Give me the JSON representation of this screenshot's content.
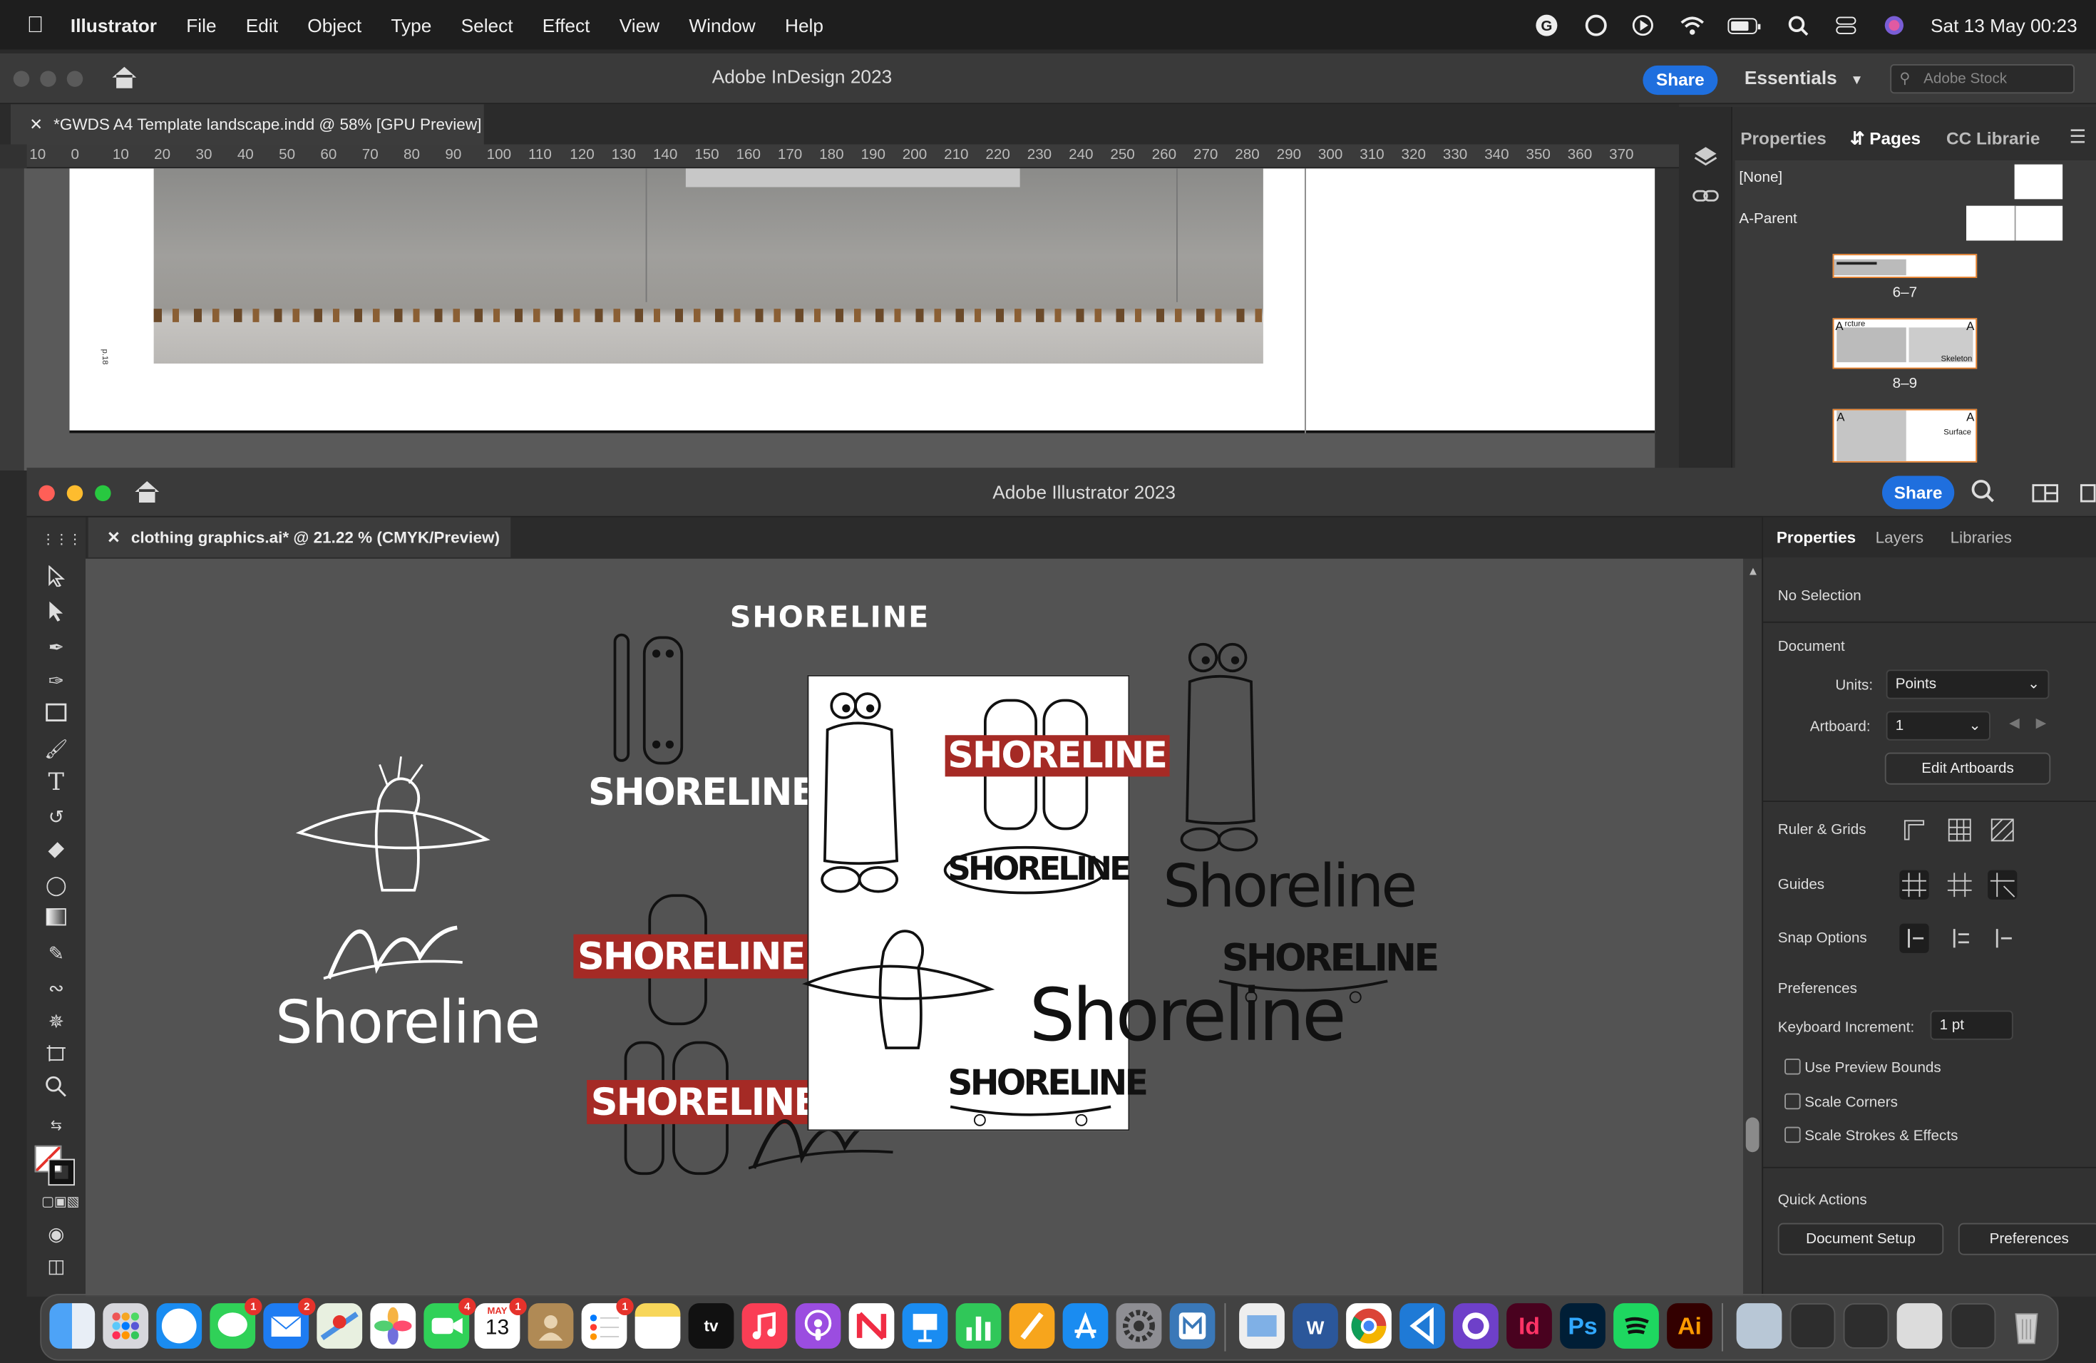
{
  "menubar": {
    "app": "Illustrator",
    "items": [
      "File",
      "Edit",
      "Object",
      "Type",
      "Select",
      "Effect",
      "View",
      "Window",
      "Help"
    ],
    "datetime": "Sat 13 May  00:23"
  },
  "indesign": {
    "title": "Adobe InDesign 2023",
    "share": "Share",
    "workspace": "Essentials",
    "stock_placeholder": "Adobe Stock",
    "doc_tab": "*GWDS A4 Template landscape.indd @ 58% [GPU Preview]",
    "ruler": [
      "10",
      "0",
      "10",
      "20",
      "30",
      "40",
      "50",
      "60",
      "70",
      "80",
      "90",
      "100",
      "110",
      "120",
      "130",
      "140",
      "150",
      "160",
      "170",
      "180",
      "190",
      "200",
      "210",
      "220",
      "230",
      "240",
      "250",
      "260",
      "270",
      "280",
      "290",
      "300",
      "310",
      "320",
      "330",
      "340",
      "350",
      "360",
      "370"
    ],
    "page_label": "p.18",
    "panel_tabs": [
      "Properties",
      "Pages",
      "CC Librarie"
    ],
    "parents": [
      "[None]",
      "A-Parent"
    ],
    "spreads": [
      "6–7",
      "8–9"
    ],
    "thumb_text": [
      "rcture",
      "Skeleton",
      "Surface"
    ],
    "parent_marker": "A"
  },
  "illustrator": {
    "title": "Adobe Illustrator 2023",
    "share": "Share",
    "doc_tab": "clothing graphics.ai* @ 21.22 % (CMYK/Preview)",
    "panel_tabs": [
      "Properties",
      "Layers",
      "Libraries"
    ],
    "no_selection": "No Selection",
    "document": "Document",
    "units_label": "Units:",
    "units_value": "Points",
    "artboard_label": "Artboard:",
    "artboard_value": "1",
    "edit_artboards": "Edit Artboards",
    "ruler_grids": "Ruler & Grids",
    "guides": "Guides",
    "snap_options": "Snap Options",
    "preferences_header": "Preferences",
    "keyboard_increment": "Keyboard Increment:",
    "keyboard_increment_value": "1 pt",
    "checkboxes": [
      "Use Preview Bounds",
      "Scale Corners",
      "Scale Strokes & Effects"
    ],
    "quick_actions": "Quick Actions",
    "document_setup": "Document Setup",
    "preferences_btn": "Preferences"
  },
  "artwork": {
    "shoreline_caps": "SHORELINE",
    "shoreline_script": "Shoreline",
    "shoreline_mixed": "SHORELINE",
    "signature": "AW"
  },
  "dock": {
    "badges": {
      "messages": "1",
      "mail": "2",
      "facetime": "4",
      "calendar": "1",
      "reminders": "1"
    },
    "calendar_month": "MAY",
    "calendar_day": "13",
    "tv_label": "tv"
  },
  "colors": {
    "accent": "#1f6fde",
    "logo_red": "#a52a25",
    "indesign": "#ff3366",
    "photoshop": "#31a8ff",
    "illustrator": "#ff9a00"
  }
}
